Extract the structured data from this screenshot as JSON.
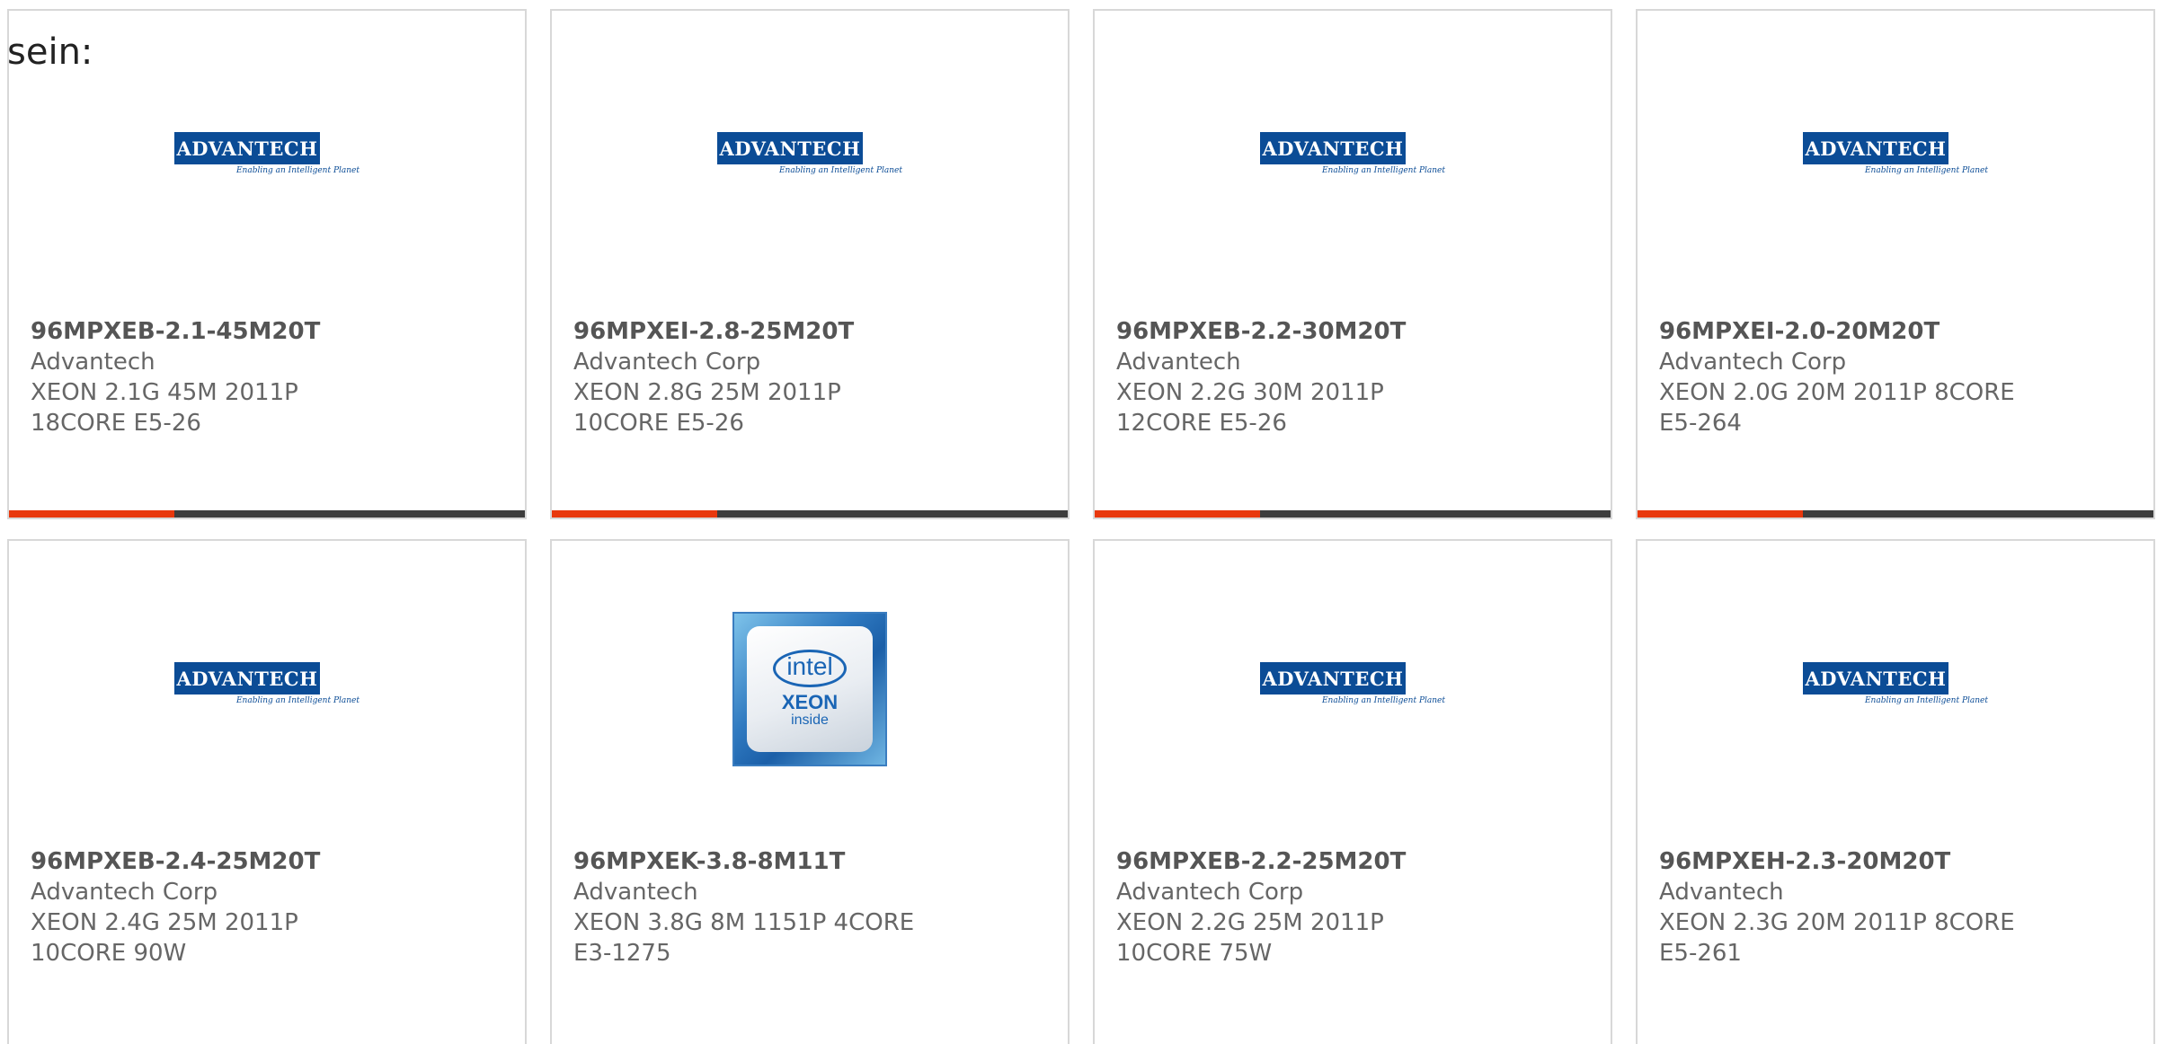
{
  "lead_text": "sein:",
  "colors": {
    "accent": "#e8380d",
    "bar": "#3d3d3d",
    "advantech_blue": "#0b4c96",
    "text": "#666666"
  },
  "logos": {
    "advantech": {
      "name": "ADVANTECH",
      "tagline": "Enabling an Intelligent Planet"
    },
    "intel": {
      "brand": "intel",
      "product": "XEON",
      "inside": "inside"
    }
  },
  "products": [
    {
      "part_number": "96MPXEB-2.1-45M20T",
      "manufacturer": "Advantech",
      "description": "XEON 2.1G 45M 2011P 18CORE E5-26",
      "logo": "advantech"
    },
    {
      "part_number": "96MPXEI-2.8-25M20T",
      "manufacturer": "Advantech Corp",
      "description": "XEON 2.8G 25M 2011P 10CORE E5-26",
      "logo": "advantech"
    },
    {
      "part_number": "96MPXEB-2.2-30M20T",
      "manufacturer": "Advantech",
      "description": "XEON 2.2G 30M 2011P 12CORE E5-26",
      "logo": "advantech"
    },
    {
      "part_number": "96MPXEI-2.0-20M20T",
      "manufacturer": "Advantech Corp",
      "description": "XEON 2.0G 20M 2011P 8CORE E5-264",
      "logo": "advantech"
    },
    {
      "part_number": "96MPXEB-2.4-25M20T",
      "manufacturer": "Advantech Corp",
      "description": "XEON 2.4G 25M 2011P 10CORE 90W",
      "logo": "advantech"
    },
    {
      "part_number": "96MPXEK-3.8-8M11T",
      "manufacturer": "Advantech",
      "description": "XEON 3.8G 8M 1151P 4CORE E3-1275",
      "logo": "intel"
    },
    {
      "part_number": "96MPXEB-2.2-25M20T",
      "manufacturer": "Advantech Corp",
      "description": "XEON 2.2G 25M 2011P 10CORE 75W",
      "logo": "advantech"
    },
    {
      "part_number": "96MPXEH-2.3-20M20T",
      "manufacturer": "Advantech",
      "description": "XEON 2.3G 20M 2011P 8CORE E5-261",
      "logo": "advantech"
    }
  ]
}
